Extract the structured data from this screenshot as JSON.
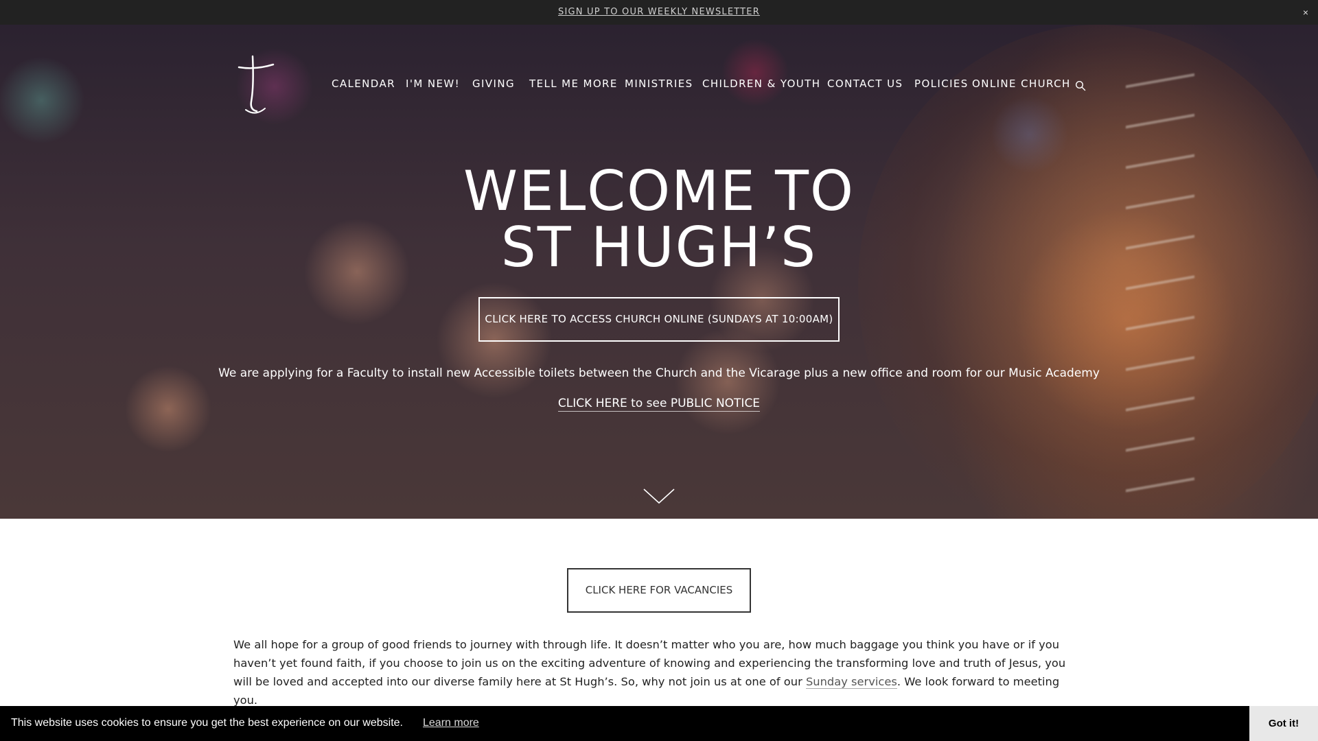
{
  "announcement": {
    "link_label": "SIGN UP TO OUR WEEKLY NEWSLETTER",
    "close_label": "×"
  },
  "header": {
    "logo_icon": "cross-logo-icon",
    "nav": [
      {
        "label": "CALENDAR"
      },
      {
        "label": "I'M NEW!"
      },
      {
        "label": "GIVING"
      },
      {
        "label": "TELL ME MORE"
      },
      {
        "label": "MINISTRIES"
      },
      {
        "label": "CHILDREN & YOUTH"
      },
      {
        "label": "CONTACT US"
      },
      {
        "label": "POLICIES"
      },
      {
        "label": "ONLINE CHURCH"
      }
    ],
    "search_icon": "search-icon"
  },
  "hero": {
    "title_line1": "WELCOME TO",
    "title_line2": "ST HUGH’S",
    "online_button_label": "CLICK HERE TO ACCESS CHURCH ONLINE (SUNDAYS AT 10:00AM)",
    "notice_text": "We are applying for a Faculty to install new Accessible toilets between the Church and the Vicarage plus a new office and room for our Music Academy",
    "public_notice_link": "CLICK HERE to see PUBLIC NOTICE",
    "scroll_icon": "chevron-down-icon"
  },
  "main": {
    "vacancies_button_label": "CLICK HERE FOR VACANCIES",
    "intro_before_link": "We all hope for a group of good friends to journey with through life. It doesn’t matter who you are, how much baggage you think you have or if you haven’t yet found faith, if you choose to join us on the exciting adventure of knowing and experiencing the transforming love and truth of Jesus, you will be loved and accepted into our diverse family here at St Hugh’s. So, why not join us at one of our ",
    "intro_link": "Sunday services",
    "intro_after_link": ". We look forward to meeting you."
  },
  "cookie_bar": {
    "message": "This website uses cookies to ensure you get the best experience on our website.",
    "learn_more": "Learn more",
    "accept_label": "Got it!"
  },
  "colors": {
    "announcement_bg": "#222222",
    "cookie_bg": "#000000",
    "text_dark": "#222222"
  }
}
